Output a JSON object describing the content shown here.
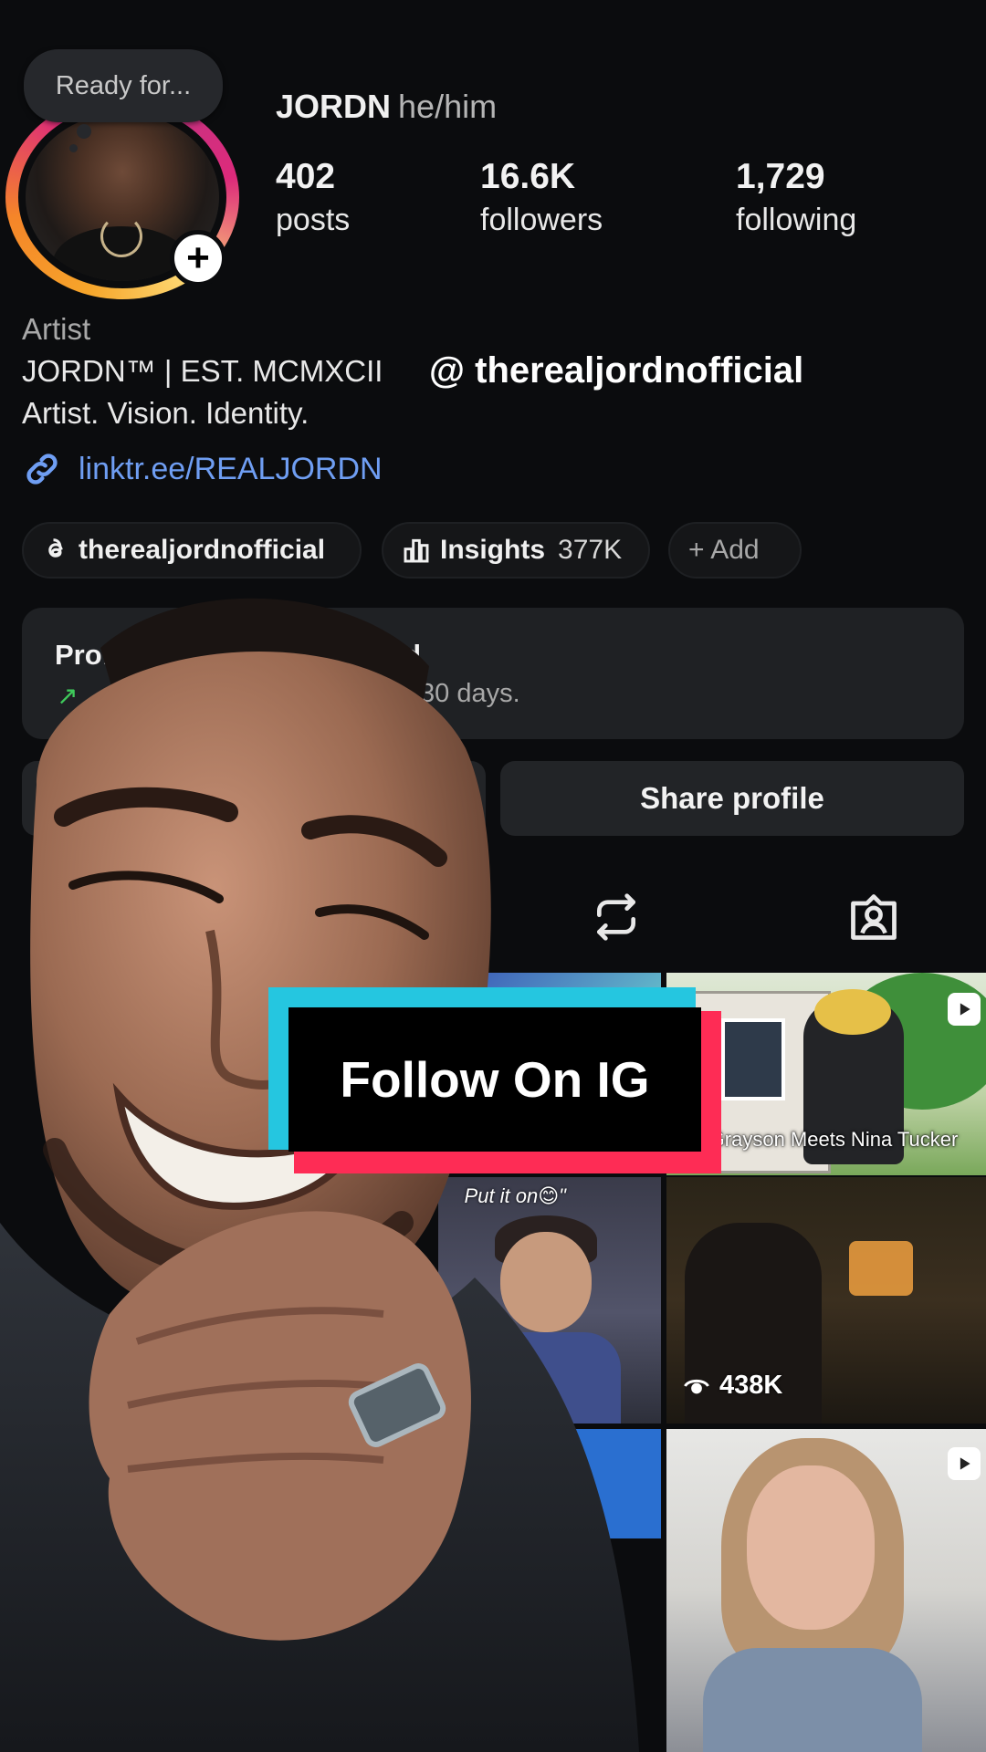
{
  "note": {
    "text": "Ready for..."
  },
  "profile": {
    "username": "JORDN",
    "pronouns": "he/him",
    "stats": [
      {
        "value": "402",
        "label": "posts"
      },
      {
        "value": "16.6K",
        "label": "followers"
      },
      {
        "value": "1,729",
        "label": "following"
      }
    ],
    "category": "Artist",
    "bio_line1": "JORDN™ | EST. MCMXCII",
    "bio_line2": "Artist. Vision. Identity.",
    "link": "linktr.ee/REALJORDN"
  },
  "overlay_handle": "@ therealjordnofficial",
  "chips": {
    "threads": "therealjordnofficial",
    "insights_label": "Insights",
    "insights_value": "377K",
    "add_label": "+ Add"
  },
  "dashboard": {
    "title_left": "Prof",
    "title_right": "rd",
    "subtitle": "30 days."
  },
  "buttons": {
    "share": "Share profile"
  },
  "grid": {
    "caption_a": "Grayson Meets Nina Tucker",
    "caption_b": "Put it on😊\"",
    "views": "438K"
  },
  "sticker": {
    "text": "Follow On IG"
  },
  "colors": {
    "link": "#6f9ef3",
    "sticker_red": "#fe2c55",
    "sticker_cyan": "#25c6e0",
    "growth_green": "#3fca5b"
  }
}
